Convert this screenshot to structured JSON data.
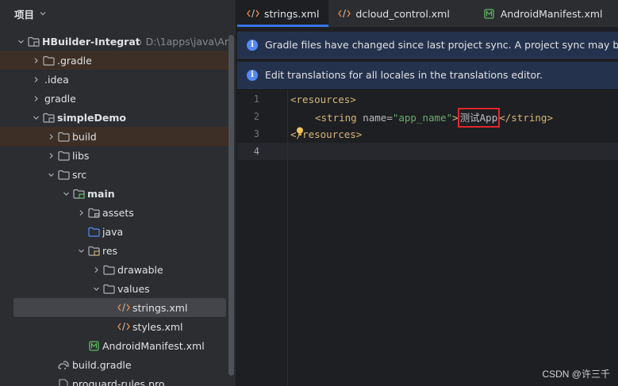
{
  "sidebar": {
    "title": "项目",
    "tree": [
      {
        "label": "HBuilder-Integrate-AS",
        "hint": "D:\\1apps\\java\\Ar",
        "bold": true,
        "arrow": "down",
        "icon": "module-folder-icon",
        "depth": 0
      },
      {
        "label": ".gradle",
        "arrow": "right",
        "icon": "folder-icon",
        "depth": 1,
        "highlight": true
      },
      {
        "label": ".idea",
        "arrow": "right",
        "icon": "none",
        "depth": 1
      },
      {
        "label": "gradle",
        "arrow": "right",
        "icon": "none",
        "depth": 1
      },
      {
        "label": "simpleDemo",
        "bold": true,
        "arrow": "down",
        "icon": "module-folder-icon",
        "depth": 1
      },
      {
        "label": "build",
        "arrow": "right",
        "icon": "folder-icon",
        "depth": 2,
        "highlight": true
      },
      {
        "label": "libs",
        "arrow": "right",
        "icon": "folder-icon",
        "depth": 2
      },
      {
        "label": "src",
        "arrow": "down",
        "icon": "folder-icon",
        "depth": 2
      },
      {
        "label": "main",
        "bold": true,
        "arrow": "down",
        "icon": "source-root-folder-icon",
        "depth": 3
      },
      {
        "label": "assets",
        "arrow": "right",
        "icon": "assets-folder-icon",
        "depth": 4
      },
      {
        "label": "java",
        "arrow": "none",
        "icon": "java-folder-icon",
        "depth": 4
      },
      {
        "label": "res",
        "arrow": "down",
        "icon": "res-folder-icon",
        "depth": 4
      },
      {
        "label": "drawable",
        "arrow": "right",
        "icon": "folder-icon",
        "depth": 5
      },
      {
        "label": "values",
        "arrow": "down",
        "icon": "folder-icon",
        "depth": 5
      },
      {
        "label": "strings.xml",
        "arrow": "none",
        "icon": "xml-file-icon",
        "depth": 6,
        "selected": true
      },
      {
        "label": "styles.xml",
        "arrow": "none",
        "icon": "xml-file-icon",
        "depth": 6
      },
      {
        "label": "AndroidManifest.xml",
        "arrow": "none",
        "icon": "manifest-file-icon",
        "depth": 4
      },
      {
        "label": "build.gradle",
        "arrow": "none",
        "icon": "gradle-file-icon",
        "depth": 2
      },
      {
        "label": "proguard-rules.pro",
        "arrow": "none",
        "icon": "text-file-icon",
        "depth": 2
      }
    ]
  },
  "tabs": [
    {
      "label": "strings.xml",
      "icon": "xml-file-icon",
      "active": true
    },
    {
      "label": "dcloud_control.xml",
      "icon": "xml-file-icon",
      "active": false
    },
    {
      "label": "AndroidManifest.xml",
      "icon": "manifest-file-icon",
      "active": false
    }
  ],
  "banners": {
    "gradle_sync": "Gradle files have changed since last project sync. A project sync may be nece",
    "translations": "Edit translations for all locales in the translations editor."
  },
  "code": {
    "line_numbers": [
      "1",
      "2",
      "3",
      "4"
    ],
    "l1_tag": "<resources>",
    "l2_open": "<string ",
    "l2_attr": "name=",
    "l2_val": "\"app_name\"",
    "l2_gt": ">",
    "l2_text": "测试App",
    "l2_close": "</string>",
    "l3_tag1": "<",
    "l3_tag2": "/resources>"
  },
  "watermark": "CSDN @许三千",
  "colors": {
    "accent": "#3574f0",
    "highlight_box": "#e0262b",
    "xml_tag": "#d5b778",
    "xml_value": "#6aab73"
  }
}
